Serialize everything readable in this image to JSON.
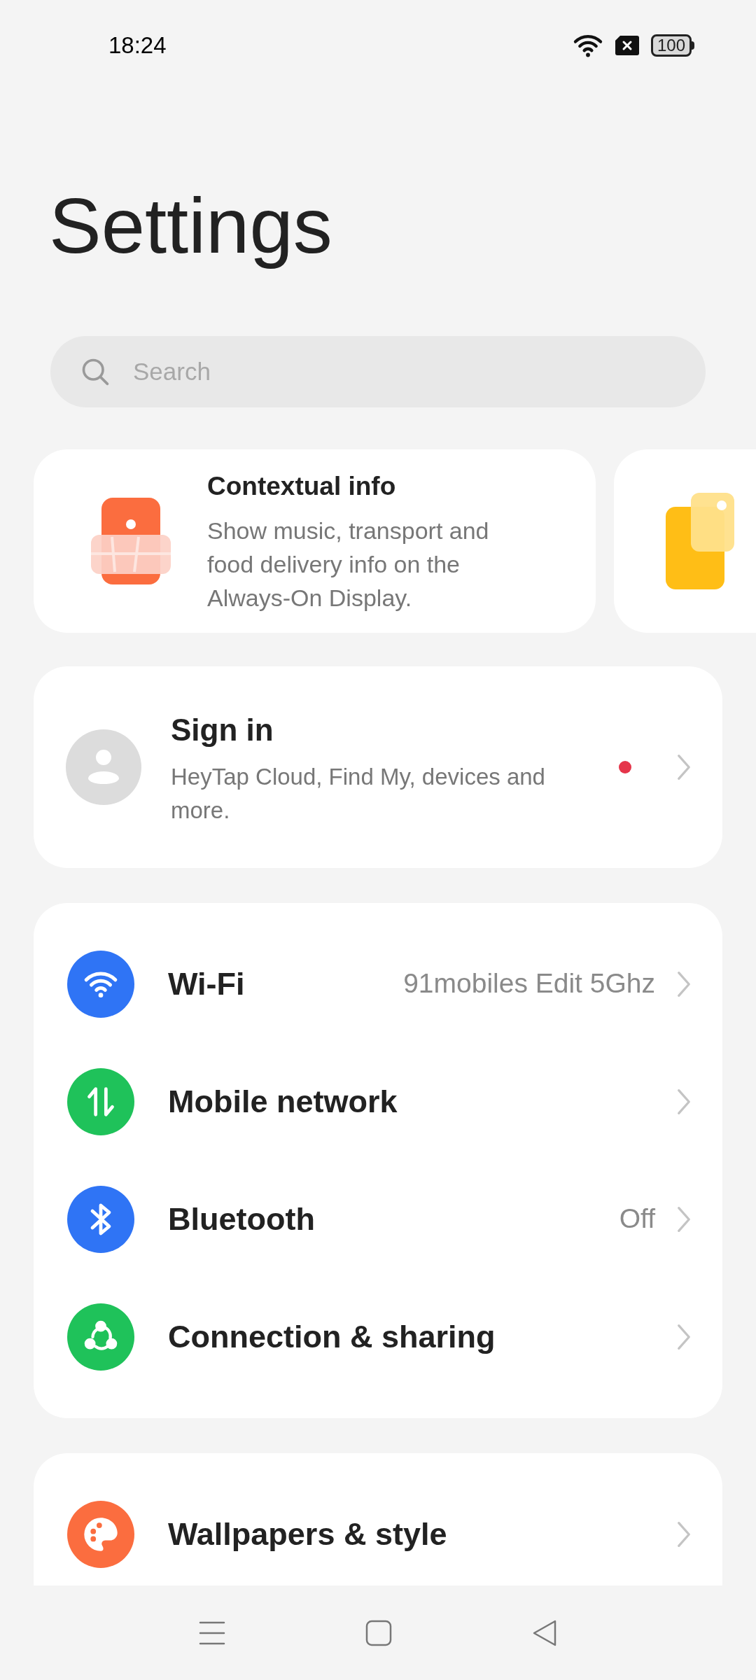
{
  "status_bar": {
    "time": "18:24",
    "battery": "100"
  },
  "title": "Settings",
  "search": {
    "placeholder": "Search"
  },
  "tips": [
    {
      "title": "Contextual info",
      "text": "Show music, transport and food delivery info on the Always-On Display."
    },
    {
      "kind": "picture"
    }
  ],
  "account": {
    "title": "Sign in",
    "subtitle": "HeyTap Cloud, Find My, devices and more.",
    "notification": true
  },
  "sections": [
    {
      "items": [
        {
          "label": "Wi-Fi",
          "value": "91mobiles Edit 5Ghz",
          "color": "#2f74f5"
        },
        {
          "label": "Mobile network",
          "color": "#1fc25a"
        },
        {
          "label": "Bluetooth",
          "value": "Off",
          "color": "#2f74f5"
        },
        {
          "label": "Connection & sharing",
          "color": "#1fc25a"
        }
      ]
    },
    {
      "items": [
        {
          "label": "Wallpapers & style",
          "color": "#fb6d3f"
        }
      ]
    }
  ]
}
